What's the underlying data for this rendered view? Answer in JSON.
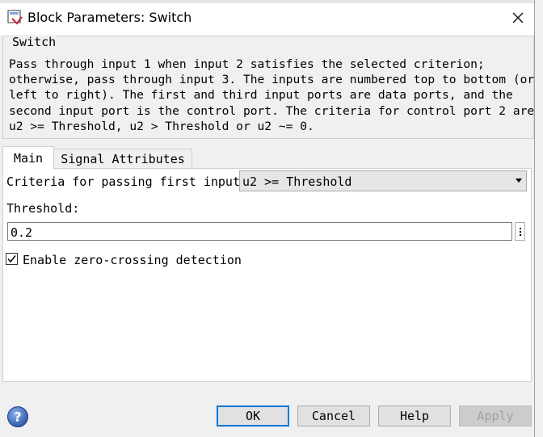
{
  "window": {
    "title": "Block Parameters: Switch"
  },
  "group": {
    "legend": "Switch",
    "description_lines": [
      "Pass through input 1 when input 2 satisfies the selected criterion;",
      "otherwise, pass through input 3. The inputs are numbered top to bottom (or",
      "left to right). The first and third input ports are data ports, and the",
      "second input port is the control port. The criteria for control port 2 are",
      "u2 >= Threshold, u2 > Threshold or u2 ~= 0."
    ]
  },
  "tabs": [
    {
      "label": "Main",
      "selected": true
    },
    {
      "label": "Signal Attributes",
      "selected": false
    }
  ],
  "main": {
    "criteria_label": "Criteria for passing first input:",
    "criteria_value": "u2 >= Threshold",
    "threshold_label": "Threshold:",
    "threshold_value": "0.2",
    "zero_crossing_label": "Enable zero-crossing detection",
    "zero_crossing_checked": true
  },
  "buttons": {
    "ok": "OK",
    "cancel": "Cancel",
    "help": "Help",
    "apply": "Apply"
  },
  "icons": {
    "app": "block-parameters-icon",
    "close": "close-icon",
    "help": "help-question-icon",
    "more": "more-options-icon",
    "dropdown": "chevron-down-icon",
    "check": "checkmark-icon"
  },
  "colors": {
    "ok_border": "#0078d7",
    "help_icon": "#3a66b8"
  }
}
